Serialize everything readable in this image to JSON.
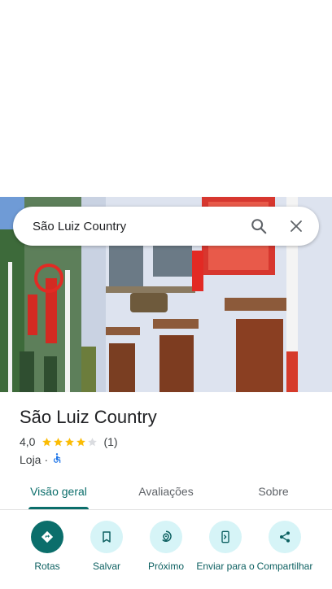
{
  "search": {
    "query": "São Luiz Country"
  },
  "place": {
    "name": "São Luiz Country",
    "rating": "4,0",
    "rating_value": 4.0,
    "review_count": "(1)",
    "category": "Loja",
    "separator": "·"
  },
  "tabs": [
    {
      "label": "Visão geral",
      "active": true
    },
    {
      "label": "Avaliações",
      "active": false
    },
    {
      "label": "Sobre",
      "active": false
    }
  ],
  "actions": [
    {
      "label": "Rotas",
      "icon": "directions-icon"
    },
    {
      "label": "Salvar",
      "icon": "bookmark-icon"
    },
    {
      "label": "Próximo",
      "icon": "nearby-icon"
    },
    {
      "label": "Enviar para o",
      "icon": "send-to-phone-icon"
    },
    {
      "label": "Compartilhar",
      "icon": "share-icon"
    }
  ],
  "colors": {
    "accent": "#0b6e6b",
    "action_bg": "#d6f4f7",
    "star": "#fbbc04",
    "star_empty": "#dadce0",
    "accessibility": "#1a73e8"
  }
}
